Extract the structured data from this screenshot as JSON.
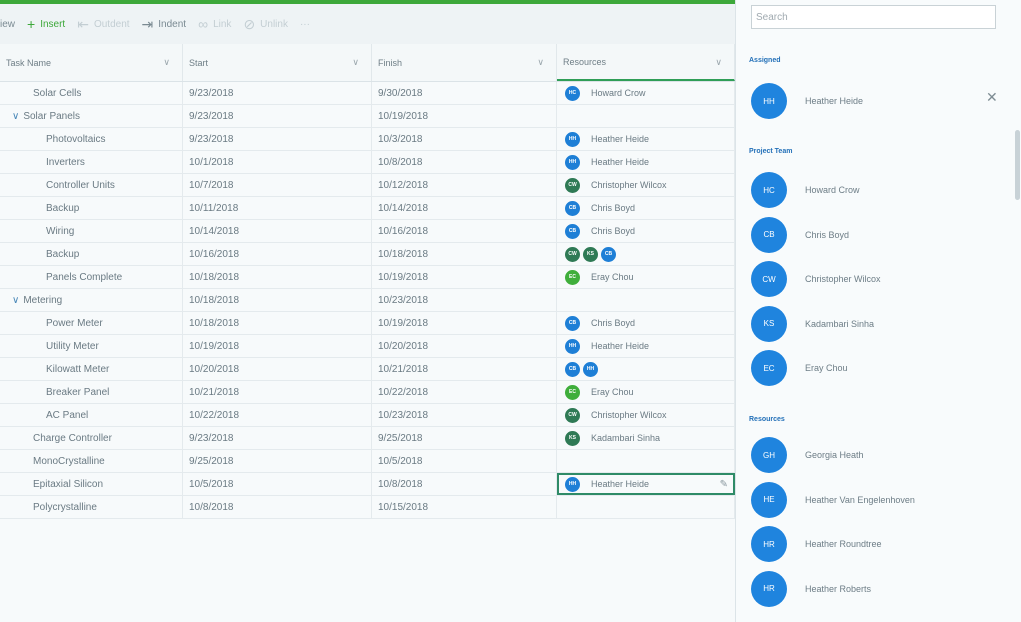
{
  "toolbar": {
    "view": "iew",
    "insert": "Insert",
    "outdent": "Outdent",
    "indent": "Indent",
    "link": "Link",
    "unlink": "Unlink",
    "more": "···"
  },
  "columns": [
    "Task Name",
    "Start",
    "Finish",
    "Resources"
  ],
  "rows": [
    {
      "name": "Solar Cells",
      "start": "9/23/2018",
      "finish": "9/30/2018",
      "avatars": [
        {
          "i": "HC",
          "c": "blue"
        }
      ],
      "res": "Howard Crow"
    },
    {
      "name": "Solar Panels",
      "start": "9/23/2018",
      "finish": "10/19/2018",
      "caret": "∨",
      "avatars": [],
      "res": ""
    },
    {
      "name": "Photovoltaics",
      "start": "9/23/2018",
      "finish": "10/3/2018",
      "avatars": [
        {
          "i": "HH",
          "c": "blue"
        }
      ],
      "res": "Heather Heide"
    },
    {
      "name": "Inverters",
      "start": "10/1/2018",
      "finish": "10/8/2018",
      "avatars": [
        {
          "i": "HH",
          "c": "blue"
        }
      ],
      "res": "Heather Heide"
    },
    {
      "name": "Controller Units",
      "start": "10/7/2018",
      "finish": "10/12/2018",
      "avatars": [
        {
          "i": "CW",
          "c": "dkgreen"
        }
      ],
      "res": "Christopher Wilcox"
    },
    {
      "name": "Backup",
      "start": "10/11/2018",
      "finish": "10/14/2018",
      "avatars": [
        {
          "i": "CB",
          "c": "blue"
        }
      ],
      "res": "Chris Boyd"
    },
    {
      "name": "Wiring",
      "start": "10/14/2018",
      "finish": "10/16/2018",
      "avatars": [
        {
          "i": "CB",
          "c": "blue"
        }
      ],
      "res": "Chris Boyd"
    },
    {
      "name": "Backup",
      "start": "10/16/2018",
      "finish": "10/18/2018",
      "avatars": [
        {
          "i": "CW",
          "c": "dkgreen"
        },
        {
          "i": "KS",
          "c": "dkgreen"
        },
        {
          "i": "CB",
          "c": "blue"
        }
      ],
      "res": ""
    },
    {
      "name": "Panels Complete",
      "start": "10/18/2018",
      "finish": "10/19/2018",
      "avatars": [
        {
          "i": "EC",
          "c": "green"
        }
      ],
      "res": "Eray Chou"
    },
    {
      "name": "Metering",
      "start": "10/18/2018",
      "finish": "10/23/2018",
      "caret": "∨",
      "avatars": [],
      "res": ""
    },
    {
      "name": "Power Meter",
      "start": "10/18/2018",
      "finish": "10/19/2018",
      "avatars": [
        {
          "i": "CB",
          "c": "blue"
        }
      ],
      "res": "Chris Boyd"
    },
    {
      "name": "Utility Meter",
      "start": "10/19/2018",
      "finish": "10/20/2018",
      "avatars": [
        {
          "i": "HH",
          "c": "blue"
        }
      ],
      "res": "Heather Heide"
    },
    {
      "name": "Kilowatt Meter",
      "start": "10/20/2018",
      "finish": "10/21/2018",
      "avatars": [
        {
          "i": "CB",
          "c": "blue"
        },
        {
          "i": "HH",
          "c": "blue"
        }
      ],
      "res": ""
    },
    {
      "name": "Breaker Panel",
      "start": "10/21/2018",
      "finish": "10/22/2018",
      "avatars": [
        {
          "i": "EC",
          "c": "green"
        }
      ],
      "res": "Eray Chou"
    },
    {
      "name": "AC Panel",
      "start": "10/22/2018",
      "finish": "10/23/2018",
      "avatars": [
        {
          "i": "CW",
          "c": "dkgreen"
        }
      ],
      "res": "Christopher Wilcox"
    },
    {
      "name": "Charge Controller",
      "start": "9/23/2018",
      "finish": "9/25/2018",
      "avatars": [
        {
          "i": "KS",
          "c": "dkgreen"
        }
      ],
      "res": "Kadambari Sinha"
    },
    {
      "name": "MonoCrystalline",
      "start": "9/25/2018",
      "finish": "10/5/2018",
      "avatars": [],
      "res": ""
    },
    {
      "name": "Epitaxial Silicon",
      "start": "10/5/2018",
      "finish": "10/8/2018",
      "avatars": [
        {
          "i": "HH",
          "c": "blue"
        }
      ],
      "res": "Heather Heide",
      "selected": true
    },
    {
      "name": "Polycrystalline",
      "start": "10/8/2018",
      "finish": "10/15/2018",
      "avatars": [],
      "res": ""
    }
  ],
  "panel": {
    "search_placeholder": "Search",
    "assigned_label": "Assigned",
    "team_label": "Project Team",
    "resources_label": "Resources",
    "assigned": [
      {
        "initials": "HH",
        "name": "Heather Heide"
      }
    ],
    "team": [
      {
        "initials": "HC",
        "name": "Howard Crow"
      },
      {
        "initials": "CB",
        "name": "Chris Boyd"
      },
      {
        "initials": "CW",
        "name": "Christopher Wilcox"
      },
      {
        "initials": "KS",
        "name": "Kadambari Sinha"
      },
      {
        "initials": "EC",
        "name": "Eray Chou"
      }
    ],
    "resources": [
      {
        "initials": "GH",
        "name": "Georgia Heath"
      },
      {
        "initials": "HE",
        "name": "Heather Van Engelenhoven"
      },
      {
        "initials": "HR",
        "name": "Heather Roundtree"
      },
      {
        "initials": "HR",
        "name": "Heather Roberts"
      }
    ]
  }
}
